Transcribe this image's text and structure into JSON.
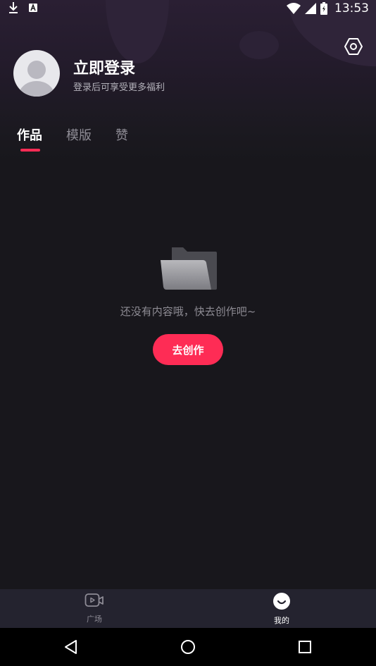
{
  "status_bar": {
    "time": "13:53"
  },
  "profile": {
    "login_title": "立即登录",
    "login_subtitle": "登录后可享受更多福利"
  },
  "tabs": [
    {
      "label": "作品",
      "active": true
    },
    {
      "label": "模版",
      "active": false
    },
    {
      "label": "赞",
      "active": false
    }
  ],
  "empty_state": {
    "message": "还没有内容哦，快去创作吧~",
    "button_label": "去创作"
  },
  "bottom_nav": [
    {
      "label": "广场",
      "icon": "video-icon",
      "active": false
    },
    {
      "label": "我的",
      "icon": "smile-icon",
      "active": true
    }
  ],
  "system_nav": [
    "back-icon",
    "home-icon",
    "recents-icon"
  ],
  "colors": {
    "accent": "#fe2c55",
    "background": "#18171c",
    "tabbar": "#24232f"
  }
}
